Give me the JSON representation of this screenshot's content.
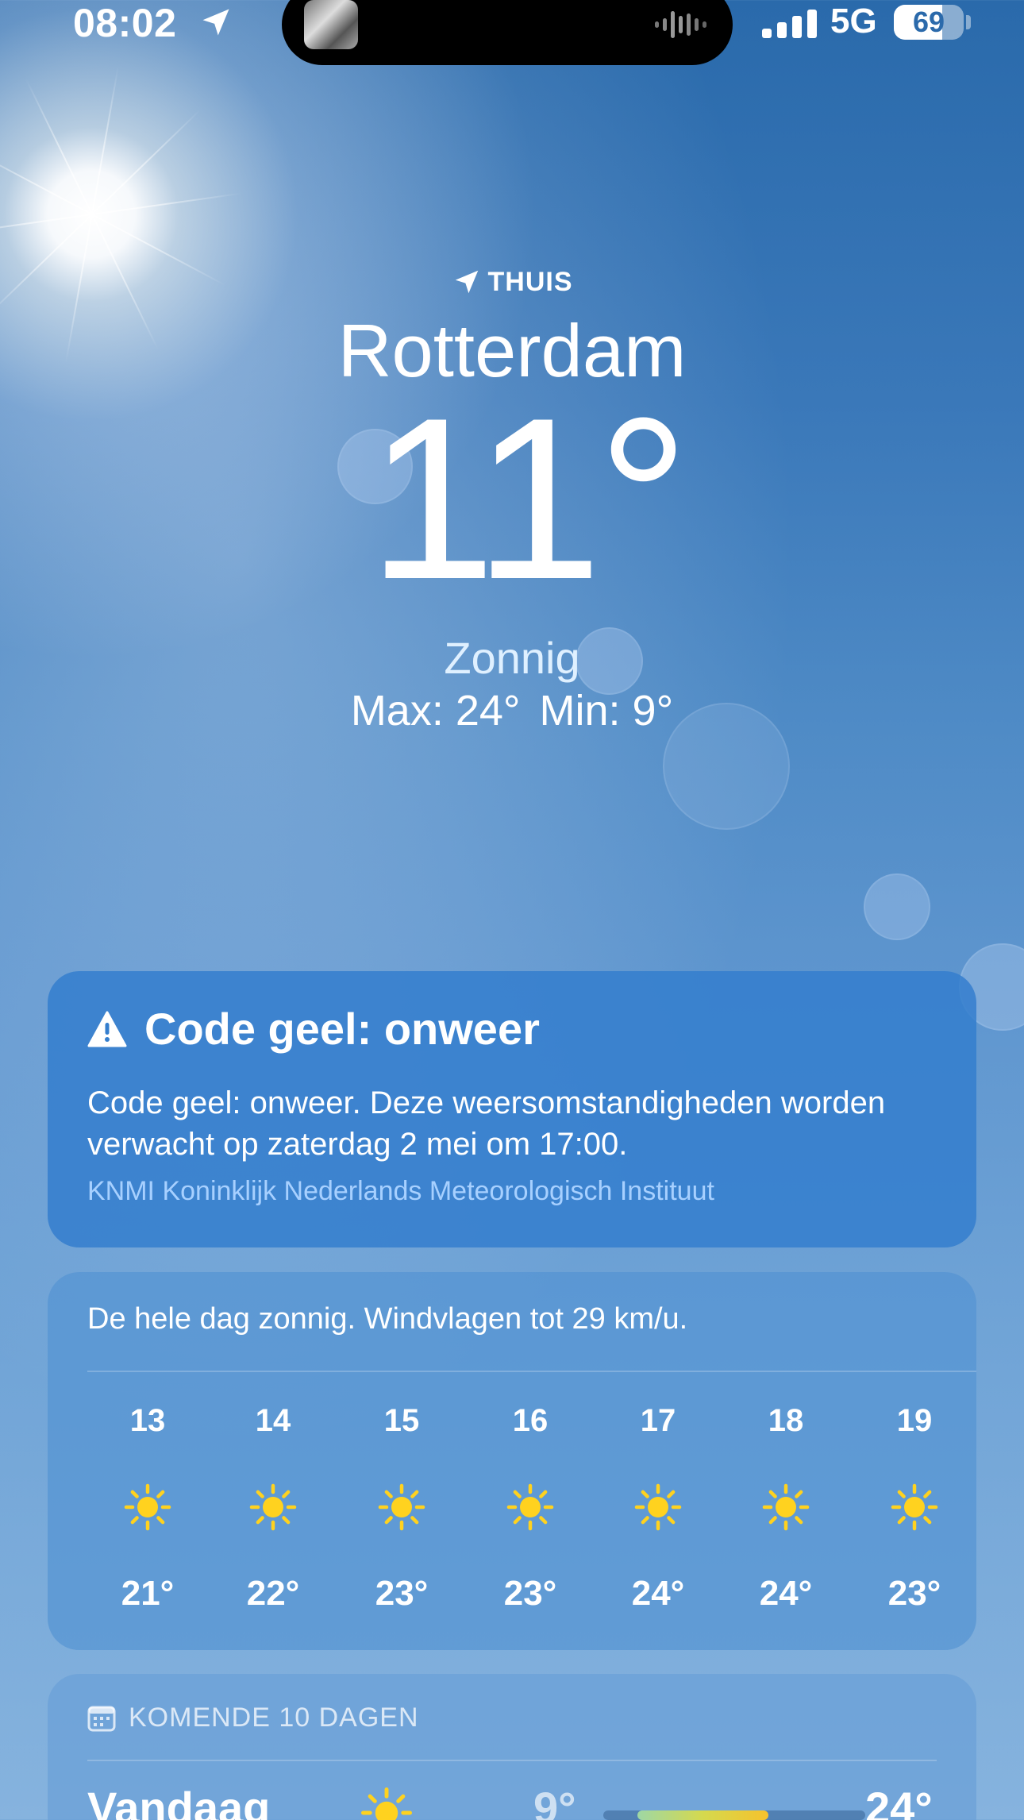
{
  "status_bar": {
    "time": "08:02",
    "network": "5G",
    "battery": "69",
    "battery_level": 0.69
  },
  "location": {
    "tag": "THUIS",
    "city": "Rotterdam",
    "temperature": "11°",
    "condition": "Zonnig",
    "max": "Max: 24°",
    "min": "Min: 9°"
  },
  "alert": {
    "title": "Code geel: onweer",
    "body": "Code geel: onweer. Deze weersomstandigheden worden verwacht op zaterdag 2 mei om 17:00.",
    "source": "KNMI Koninklijk Nederlands Meteorologisch Instituut"
  },
  "hourly": {
    "summary": "De hele dag zonnig. Windvlagen tot 29 km/u.",
    "items": [
      {
        "hour": "13",
        "icon": "sun-icon",
        "temp": "21°"
      },
      {
        "hour": "14",
        "icon": "sun-icon",
        "temp": "22°"
      },
      {
        "hour": "15",
        "icon": "sun-icon",
        "temp": "23°"
      },
      {
        "hour": "16",
        "icon": "sun-icon",
        "temp": "23°"
      },
      {
        "hour": "17",
        "icon": "sun-icon",
        "temp": "24°"
      },
      {
        "hour": "18",
        "icon": "sun-icon",
        "temp": "24°"
      },
      {
        "hour": "19",
        "icon": "sun-icon",
        "temp": "23°"
      }
    ]
  },
  "daily": {
    "header": "KOMENDE 10 DAGEN",
    "rows": [
      {
        "day": "Vandaag",
        "icon": "sun-icon",
        "min": "9°",
        "max": "24°",
        "range_start": 0.13,
        "range_end": 0.63
      }
    ]
  },
  "colors": {
    "sun": "#FFD21F",
    "alert_card": "#347ECE",
    "link": "#A7D0FF"
  }
}
